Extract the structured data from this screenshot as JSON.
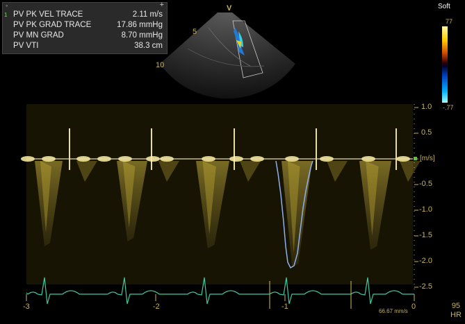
{
  "measurements": {
    "rows": [
      {
        "index": "1",
        "label": "PV PK VEL TRACE",
        "value": "2.11 m/s"
      },
      {
        "index": "",
        "label": "PV PK GRAD TRACE",
        "value": "17.86 mmHg"
      },
      {
        "index": "",
        "label": "PV MN GRAD",
        "value": "8.70 mmHg"
      },
      {
        "index": "",
        "label": "PV VTI",
        "value": "38.3 cm"
      }
    ]
  },
  "image_marker": "V",
  "depth_labels": [
    "5",
    "10"
  ],
  "color_map": {
    "preset": "Soft",
    "max": "77",
    "min": "-.77"
  },
  "velocity_scale": {
    "unit": "[m/s]",
    "ticks": [
      "1.0",
      "0.5",
      "-0.5",
      "-1.0",
      "-1.5",
      "-2.0",
      "-2.5"
    ]
  },
  "time_axis": {
    "ticks": [
      "-3",
      "-2",
      "-1",
      "0"
    ]
  },
  "sweep_speed": "66.67 mm/s",
  "heart_rate": {
    "value": "95",
    "label": "HR"
  },
  "colors": {
    "trace": "#d2b83a",
    "ecg": "#3ec9a2",
    "envelope": "#7fa8e8",
    "panel": "#2a2a2a"
  }
}
